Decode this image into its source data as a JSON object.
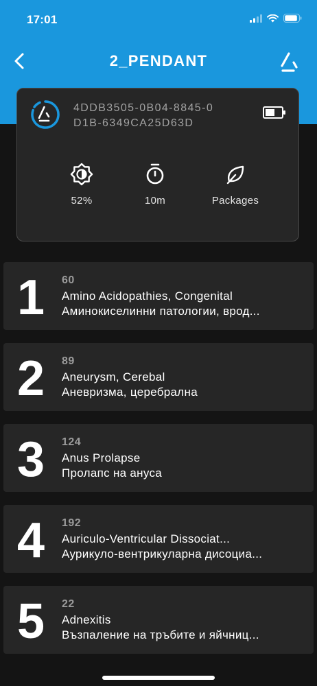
{
  "status_bar": {
    "time": "17:01"
  },
  "header": {
    "title": "2_PENDANT"
  },
  "device_card": {
    "id_line1": "4DDB3505-0B04-8845-0",
    "id_line2": "D1B-6349CA25D63D",
    "stats": [
      {
        "icon": "brightness-icon",
        "label": "52%"
      },
      {
        "icon": "timer-icon",
        "label": "10m"
      },
      {
        "icon": "leaf-icon",
        "label": "Packages"
      }
    ]
  },
  "list": [
    {
      "rank": "1",
      "count": "60",
      "title_en": "Amino Acidopathies, Congenital",
      "title_bg": "Аминокиселинни патологии, врод..."
    },
    {
      "rank": "2",
      "count": "89",
      "title_en": "Aneurysm, Cerebal",
      "title_bg": "Аневризма, церебрална"
    },
    {
      "rank": "3",
      "count": "124",
      "title_en": "Anus Prolapse",
      "title_bg": "Пролапс на ануса"
    },
    {
      "rank": "4",
      "count": "192",
      "title_en": "Auriculo-Ventricular Dissociat...",
      "title_bg": "Аурикуло-вентрикуларна дисоциа..."
    },
    {
      "rank": "5",
      "count": "22",
      "title_en": "Adnexitis",
      "title_bg": "Възпаление на тръбите и яйчниц..."
    }
  ],
  "colors": {
    "accent": "#1a97dd",
    "background": "#141414",
    "card": "#262626"
  }
}
